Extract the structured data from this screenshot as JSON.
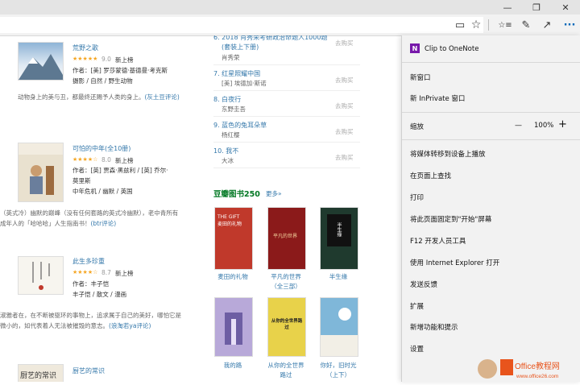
{
  "window": {
    "minimize": "—",
    "maximize": "❐",
    "close": "✕"
  },
  "toolbar": {
    "reading_icon": "▭",
    "favorite_icon": "☆",
    "favorites_hub_icon": "☆≡",
    "pen_icon": "✎",
    "share_icon": "↗",
    "more_icon": "···"
  },
  "left_books": [
    {
      "title": "荒野之歌",
      "rating": "9.0",
      "badge": "新上榜",
      "author": "作者：[美] 罗莎蒙德·基德曼·考克斯",
      "tags": "摄影 / 自然 / 野生动物",
      "desc1": "动物身上的美与丑，都最终还赐予人类的身上。",
      "desc_link": "(灰土豆评论)"
    },
    {
      "title": "可怕的中年(全10册)",
      "rating": "8.0",
      "badge": "新上榜",
      "author": "作者：[英] 贾森·黑兹利 / [英] 乔尔·莫里斯",
      "tags": "中年危机 / 幽默 / 英国",
      "desc1": "（英式冷）幽默的巅峰（没有任何套路的英式冷幽默），老中青所有成年人的「哈哈哈」人生指南书！",
      "desc_link": "(btr评论)"
    },
    {
      "title": "此生多珍重",
      "rating": "8.7",
      "badge": "新上榜",
      "author": "作者：丰子恺",
      "tags": "丰子恺 / 散文 / 漫画",
      "desc1": "淑雅者在，在不断被驱环的事物上，追求属于自己的美好，哪怕它是微小的，如代表着人无法被摧毁的意志。",
      "desc_link": "(浪淘若ya评论)"
    },
    {
      "title": "厨艺的常识",
      "cover_text": "厨艺的常识"
    }
  ],
  "ranking": [
    {
      "num": "6.",
      "title": "2018 肖秀荣考研政治命题人1000题(套装上下册)",
      "title_l1": "6. 2018 肖秀荣考研政治命题人1000题",
      "title_l2": "(套装上下册)",
      "author": "肖秀荣",
      "buy": "去购买"
    },
    {
      "title": "7. 红星照耀中国",
      "author": "[美] 埃德加·斯诺",
      "buy": "去购买"
    },
    {
      "title": "8. 白夜行",
      "author": "东野圭吾",
      "buy": "去购买"
    },
    {
      "title": "9. 蓝色的兔耳朵草",
      "author": "杨红樱",
      "buy": "去购买"
    },
    {
      "title": "10. 我不",
      "author": "大冰",
      "buy": "去购买"
    }
  ],
  "top250": {
    "heading": "豆瓣图书250",
    "more": "更多»",
    "books": [
      {
        "caption": "麦田的礼物",
        "cover_text": "THE GIFT\n麦田的礼物",
        "color": "#c0392b"
      },
      {
        "caption": "平凡的世界（全三部）",
        "cap1": "平凡的世界",
        "cap2": "（全三部）",
        "cover_text": "平凡的世界",
        "color": "#8b1a1a"
      },
      {
        "caption": "半生缘",
        "cover_text": "半生缘",
        "color": "#1f3a2e"
      },
      {
        "caption": "我的路",
        "color": "#b8a9d9"
      },
      {
        "caption": "从你的全世界路过",
        "cap1": "从你的全世界",
        "cap2": "路过",
        "cover_text": "从你的全世界路过",
        "color": "#e8d24a"
      },
      {
        "caption": "你好，旧时光（上下）",
        "cap1": "你好，旧时光",
        "cap2": "（上下）",
        "color": "#7fb7d9"
      }
    ]
  },
  "menu": {
    "clip": "Clip to OneNote",
    "new_window": "新窗口",
    "inprivate": "新 InPrivate 窗口",
    "zoom_label": "缩放",
    "zoom_minus": "—",
    "zoom_value": "100%",
    "zoom_plus": "+",
    "cast": "将媒体转移到设备上播放",
    "find": "在页面上查找",
    "print": "打印",
    "pin": "将此页面固定到\"开始\"屏幕",
    "devtools": "F12 开发人员工具",
    "open_ie": "使用 Internet Explorer 打开",
    "feedback": "发送反馈",
    "extensions": "扩展",
    "whatsnew": "新增功能和提示",
    "settings": "设置"
  },
  "watermark": {
    "brand": "Office教程网",
    "url": "www.office26.com"
  }
}
